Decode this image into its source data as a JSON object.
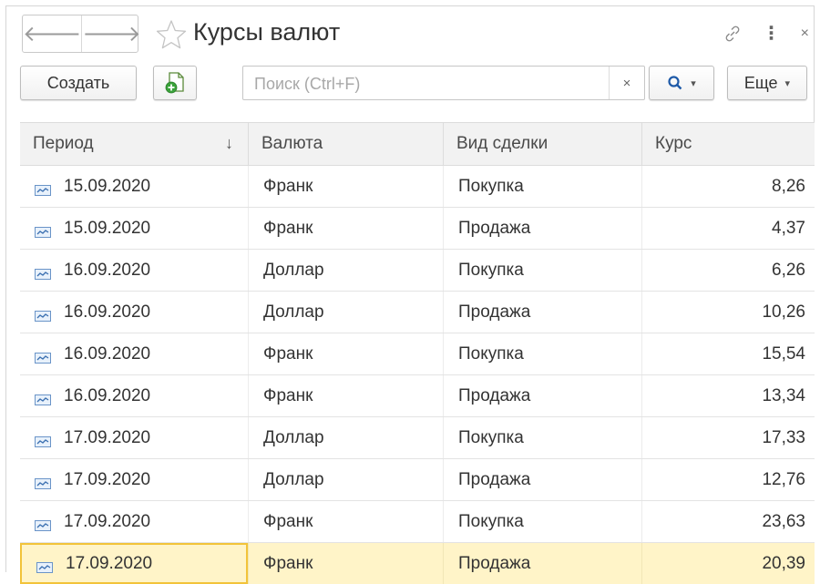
{
  "window": {
    "title": "Курсы валют",
    "nav_back_glyph": "🡐",
    "nav_forward_glyph": "🡒",
    "more_glyph": "⋮",
    "close_glyph": "×",
    "accent_color": "#f2c33a"
  },
  "toolbar": {
    "create_label": "Создать",
    "search_placeholder": "Поиск (Ctrl+F)",
    "search_value": "",
    "search_clear_glyph": "×",
    "find_glyph": "Q",
    "find_caret": "▾",
    "more_label": "Еще",
    "more_caret": "▾"
  },
  "table": {
    "columns": [
      "Период",
      "Валюта",
      "Вид сделки",
      "Курс"
    ],
    "sort_glyph": "↓",
    "rows": [
      {
        "date": "15.09.2020",
        "currency": "Франк",
        "deal": "Покупка",
        "rate": "8,26"
      },
      {
        "date": "15.09.2020",
        "currency": "Франк",
        "deal": "Продажа",
        "rate": "4,37"
      },
      {
        "date": "16.09.2020",
        "currency": "Доллар",
        "deal": "Покупка",
        "rate": "6,26"
      },
      {
        "date": "16.09.2020",
        "currency": "Доллар",
        "deal": "Продажа",
        "rate": "10,26"
      },
      {
        "date": "16.09.2020",
        "currency": "Франк",
        "deal": "Покупка",
        "rate": "15,54"
      },
      {
        "date": "16.09.2020",
        "currency": "Франк",
        "deal": "Продажа",
        "rate": "13,34"
      },
      {
        "date": "17.09.2020",
        "currency": "Доллар",
        "deal": "Покупка",
        "rate": "17,33"
      },
      {
        "date": "17.09.2020",
        "currency": "Доллар",
        "deal": "Продажа",
        "rate": "12,76"
      },
      {
        "date": "17.09.2020",
        "currency": "Франк",
        "deal": "Покупка",
        "rate": "23,63"
      },
      {
        "date": "17.09.2020",
        "currency": "Франк",
        "deal": "Продажа",
        "rate": "20,39"
      }
    ],
    "selected_row": 9
  }
}
